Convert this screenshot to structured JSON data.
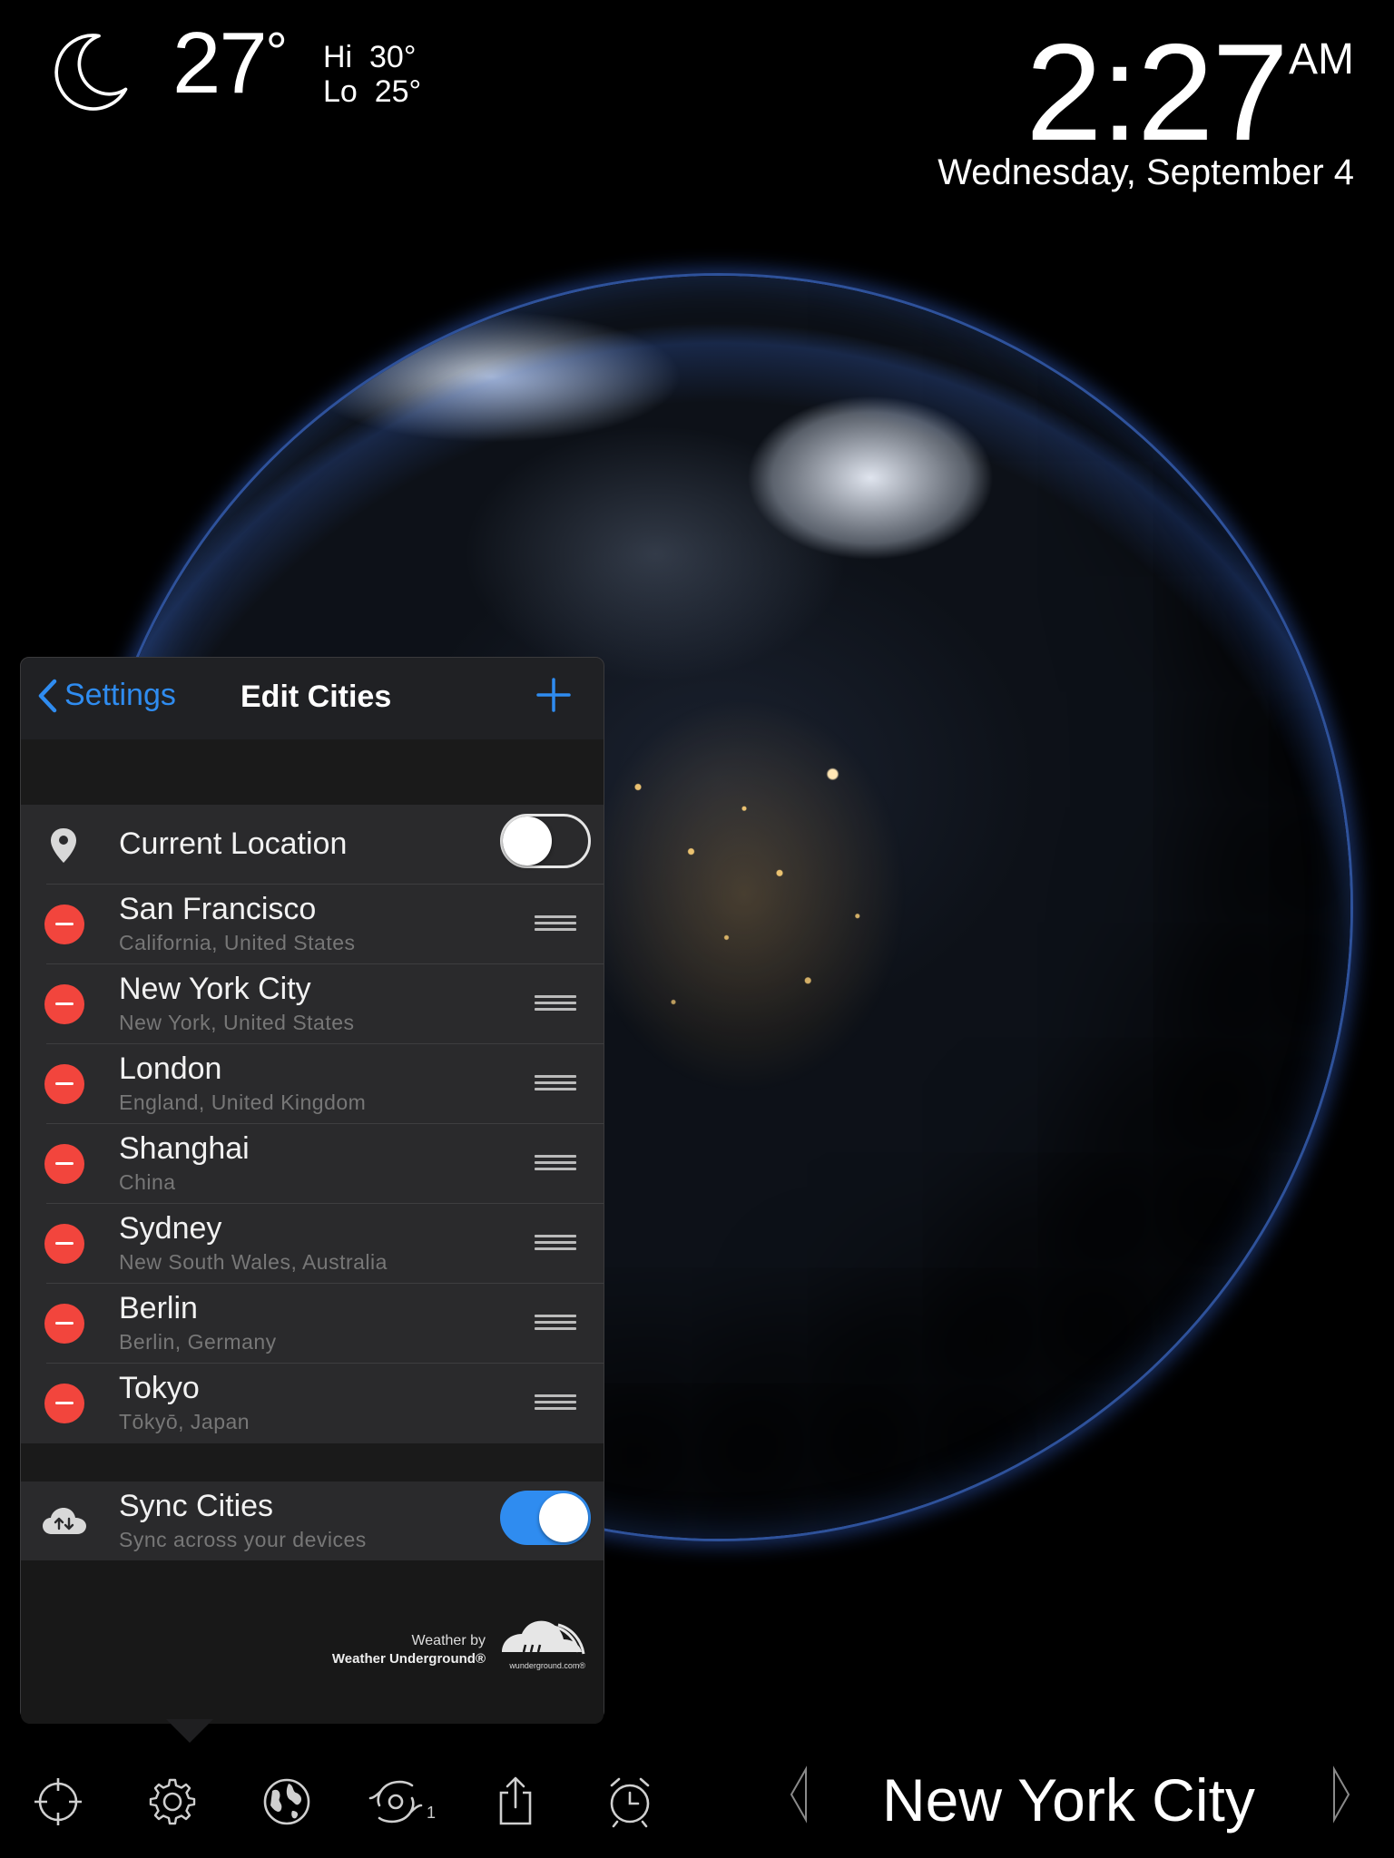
{
  "weather": {
    "temperature": "27",
    "degree_symbol": "°",
    "hi_label": "Hi",
    "hi_value": "30°",
    "lo_label": "Lo",
    "lo_value": "25°",
    "icon": "crescent-moon-icon"
  },
  "clock": {
    "time": "2:27",
    "ampm": "AM",
    "date": "Wednesday, September 4"
  },
  "panel": {
    "back_label": "Settings",
    "title": "Edit Cities",
    "add_icon": "plus-icon",
    "current_location": {
      "label": "Current Location",
      "enabled": false
    },
    "cities": [
      {
        "name": "San Francisco",
        "region": "California, United States"
      },
      {
        "name": "New York City",
        "region": "New York, United States"
      },
      {
        "name": "London",
        "region": "England, United Kingdom"
      },
      {
        "name": "Shanghai",
        "region": "China"
      },
      {
        "name": "Sydney",
        "region": "New South Wales, Australia"
      },
      {
        "name": "Berlin",
        "region": "Berlin, Germany"
      },
      {
        "name": "Tokyo",
        "region": "Tōkyō, Japan"
      }
    ],
    "sync": {
      "label": "Sync Cities",
      "sublabel": "Sync across your devices",
      "enabled": true
    },
    "credit": {
      "line1": "Weather by",
      "line2": "Weather Underground®",
      "logo_caption": "wunderground.com®"
    }
  },
  "toolbar": {
    "items": [
      "crosshair-icon",
      "gear-icon",
      "globe-icon",
      "hurricane-icon",
      "share-icon",
      "alarm-clock-icon"
    ],
    "hurricane_badge": "1",
    "current_city": "New York City"
  },
  "colors": {
    "accent": "#2f8cf0",
    "delete": "#f2453d",
    "background": "#000000",
    "panel": "#1f1f21"
  }
}
